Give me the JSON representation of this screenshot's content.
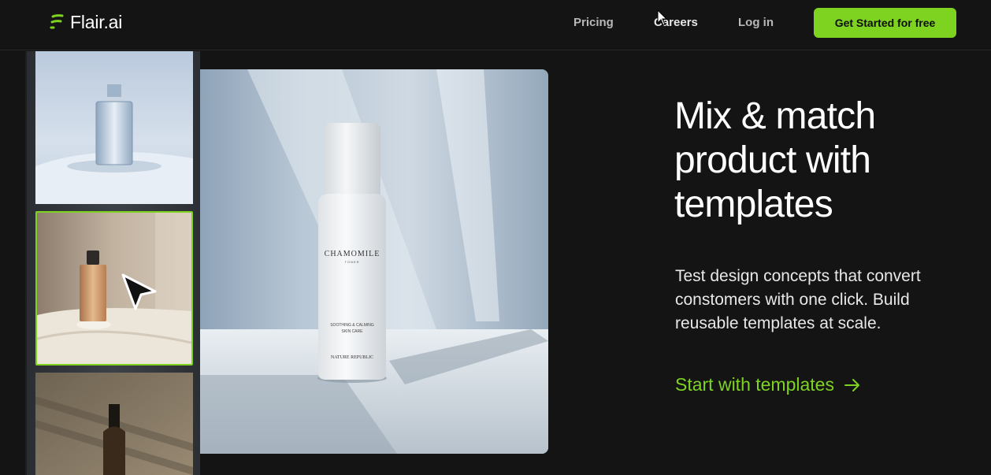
{
  "brand": {
    "name": "Flair.ai",
    "accent_color": "#7ed321",
    "logo_icon": "flair-logo-icon"
  },
  "nav": {
    "pricing": "Pricing",
    "careers": "Careers",
    "login": "Log in",
    "cta": "Get Started  for free"
  },
  "thumbnails": [
    {
      "subject": "perfume bottle",
      "selected": false
    },
    {
      "subject": "fragrance bottle on fabric",
      "selected": true
    },
    {
      "subject": "dark perfume bottle",
      "selected": false
    }
  ],
  "main_image": {
    "label_title": "CHAMOMILE",
    "label_subtitle": "TONER",
    "label_line1": "SOOTHING & CALMING",
    "label_line2": "SKIN CARE",
    "label_brand": "NATURE REPUBLIC"
  },
  "hero": {
    "headline_line1": "Mix & match",
    "headline_line2": "product with",
    "headline_line3": "templates",
    "description": "Test design concepts that convert constomers with one click. Build reusable templates at scale.",
    "link_label": "Start with templates",
    "link_icon": "arrow-right-icon"
  }
}
